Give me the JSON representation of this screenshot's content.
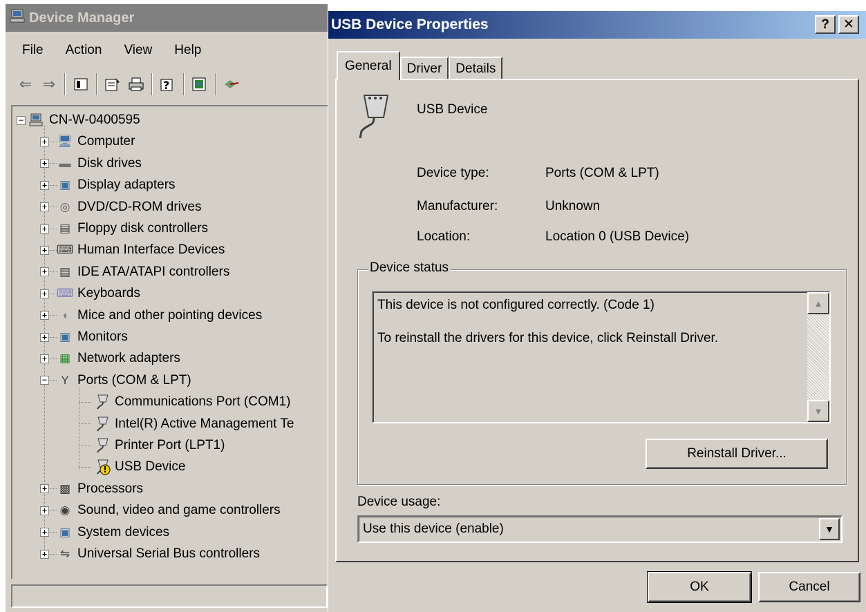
{
  "device_manager": {
    "title": "Device Manager",
    "menu": [
      "File",
      "Action",
      "View",
      "Help"
    ],
    "toolbar_icons": [
      "back-arrow-icon",
      "forward-arrow-icon",
      "show-hide-console-tree-icon",
      "properties-icon",
      "print-icon",
      "help-icon",
      "update-driver-icon",
      "scan-hardware-icon"
    ],
    "tree": {
      "root": "CN-W-0400595",
      "categories": [
        {
          "label": "Computer",
          "icon": "computer-icon",
          "expanded": false
        },
        {
          "label": "Disk drives",
          "icon": "disk-drive-icon",
          "expanded": false
        },
        {
          "label": "Display adapters",
          "icon": "display-adapter-icon",
          "expanded": false
        },
        {
          "label": "DVD/CD-ROM drives",
          "icon": "dvd-icon",
          "expanded": false
        },
        {
          "label": "Floppy disk controllers",
          "icon": "floppy-controller-icon",
          "expanded": false
        },
        {
          "label": "Human Interface Devices",
          "icon": "hid-icon",
          "expanded": false
        },
        {
          "label": "IDE ATA/ATAPI controllers",
          "icon": "ide-controller-icon",
          "expanded": false
        },
        {
          "label": "Keyboards",
          "icon": "keyboard-icon",
          "expanded": false
        },
        {
          "label": "Mice and other pointing devices",
          "icon": "mouse-icon",
          "expanded": false
        },
        {
          "label": "Monitors",
          "icon": "monitor-icon",
          "expanded": false
        },
        {
          "label": "Network adapters",
          "icon": "network-adapter-icon",
          "expanded": false
        },
        {
          "label": "Ports (COM & LPT)",
          "icon": "port-icon",
          "expanded": true
        },
        {
          "label": "Processors",
          "icon": "processor-icon",
          "expanded": false
        },
        {
          "label": "Sound, video and game controllers",
          "icon": "sound-icon",
          "expanded": false
        },
        {
          "label": "System devices",
          "icon": "system-device-icon",
          "expanded": false
        },
        {
          "label": "Universal Serial Bus controllers",
          "icon": "usb-icon",
          "expanded": false
        }
      ],
      "ports_children": [
        {
          "label": "Communications Port (COM1)",
          "warning": false
        },
        {
          "label": "Intel(R) Active Management Te",
          "warning": false
        },
        {
          "label": "Printer Port (LPT1)",
          "warning": false
        },
        {
          "label": "USB Device",
          "warning": true
        }
      ]
    }
  },
  "dialog": {
    "title": "USB Device Properties",
    "caption_help": "?",
    "caption_close": "✕",
    "tabs": [
      "General",
      "Driver",
      "Details"
    ],
    "active_tab": "General",
    "device_name": "USB Device",
    "properties": [
      {
        "label": "Device type:",
        "value": "Ports (COM & LPT)"
      },
      {
        "label": "Manufacturer:",
        "value": "Unknown"
      },
      {
        "label": "Location:",
        "value": "Location 0 (USB Device)"
      }
    ],
    "status_group_title": "Device status",
    "status_line1": "This device is not configured correctly. (Code 1)",
    "status_line2": "To reinstall the drivers for this device, click Reinstall Driver.",
    "reinstall_button": "Reinstall Driver...",
    "usage_label": "Device usage:",
    "usage_value": "Use this device (enable)",
    "ok_button": "OK",
    "cancel_button": "Cancel"
  },
  "colors": {
    "title_active_start": "#0a246a",
    "title_active_end": "#a6caf0",
    "title_inactive": "#808080",
    "face": "#d4d0c8",
    "warning": "#ffcc00"
  }
}
